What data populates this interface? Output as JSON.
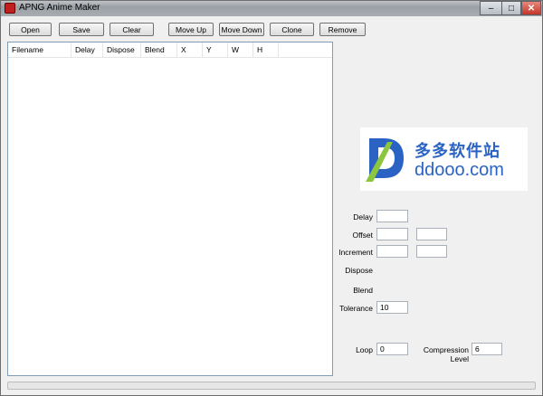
{
  "window": {
    "title": "APNG Anime Maker",
    "close_glyph": "✕"
  },
  "toolbar": {
    "open_label": "Open",
    "save_label": "Save",
    "clear_label": "Clear",
    "move_up_label": "Move Up",
    "move_down_label": "Move Down",
    "clone_label": "Clone",
    "remove_label": "Remove"
  },
  "list": {
    "columns": [
      "Filename",
      "Delay",
      "Dispose",
      "Blend",
      "X",
      "Y",
      "W",
      "H"
    ]
  },
  "watermark": {
    "cn": "多多软件站",
    "en": "ddooo.com",
    "brand_color": "#2b63c4"
  },
  "properties": {
    "delay_label": "Delay",
    "delay_value": "",
    "offset_label": "Offset",
    "offset_x": "",
    "offset_y": "",
    "increment_label": "Increment",
    "increment_x": "",
    "increment_y": "",
    "dispose_label": "Dispose",
    "blend_label": "Blend",
    "tolerance_label": "Tolerance",
    "tolerance_value": "10",
    "loop_label": "Loop",
    "loop_value": "0",
    "compression_label": "Compression Level",
    "compression_value": "6"
  },
  "progress": {
    "fraction": 0.0
  }
}
